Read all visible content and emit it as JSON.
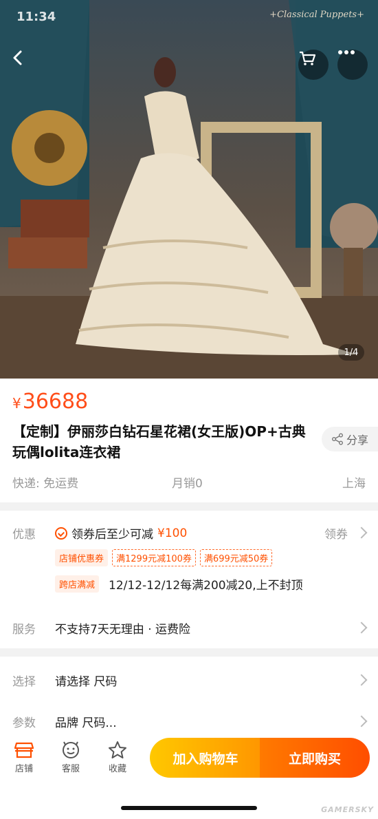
{
  "status": {
    "time": "11:34"
  },
  "hero": {
    "brand_text": "+Classical Puppets+",
    "page_indicator": "1/4"
  },
  "nav": {
    "back": "back-arrow-icon",
    "cart": "cart-icon",
    "more": "more-icon"
  },
  "product": {
    "currency": "¥",
    "price": "36688",
    "title": "【定制】伊丽莎白钻石星花裙(女王版)OP+古典玩偶lolita连衣裙",
    "share_label": "分享",
    "shipping": "快递: 免运费",
    "monthly_sales": "月销0",
    "location": "上海"
  },
  "promo": {
    "label": "优惠",
    "coupon_text": "领券后至少可减",
    "coupon_amount": "¥100",
    "claim_label": "领券",
    "shop_coupon_tag": "店铺优惠券",
    "tickets": [
      "满1299元减100券",
      "满699元减50券"
    ],
    "cross_store_tag": "跨店满减",
    "cross_store_text": "12/12-12/12每满200减20,上不封顶"
  },
  "service": {
    "label": "服务",
    "value": "不支持7天无理由 · 运费险"
  },
  "selection": {
    "choose_label": "选择",
    "choose_value": "请选择 尺码",
    "params_label": "参数",
    "params_value": "品牌 尺码..."
  },
  "bottom_bar": {
    "shop": "店铺",
    "customer_service": "客服",
    "favorite": "收藏",
    "add_to_cart": "加入购物车",
    "buy_now": "立即购买"
  },
  "watermark": "GAMERSKY",
  "colors": {
    "accent": "#ff5000",
    "price": "#ff4e1a",
    "cart_start": "#ffc800",
    "buy_end": "#ff4e00"
  }
}
